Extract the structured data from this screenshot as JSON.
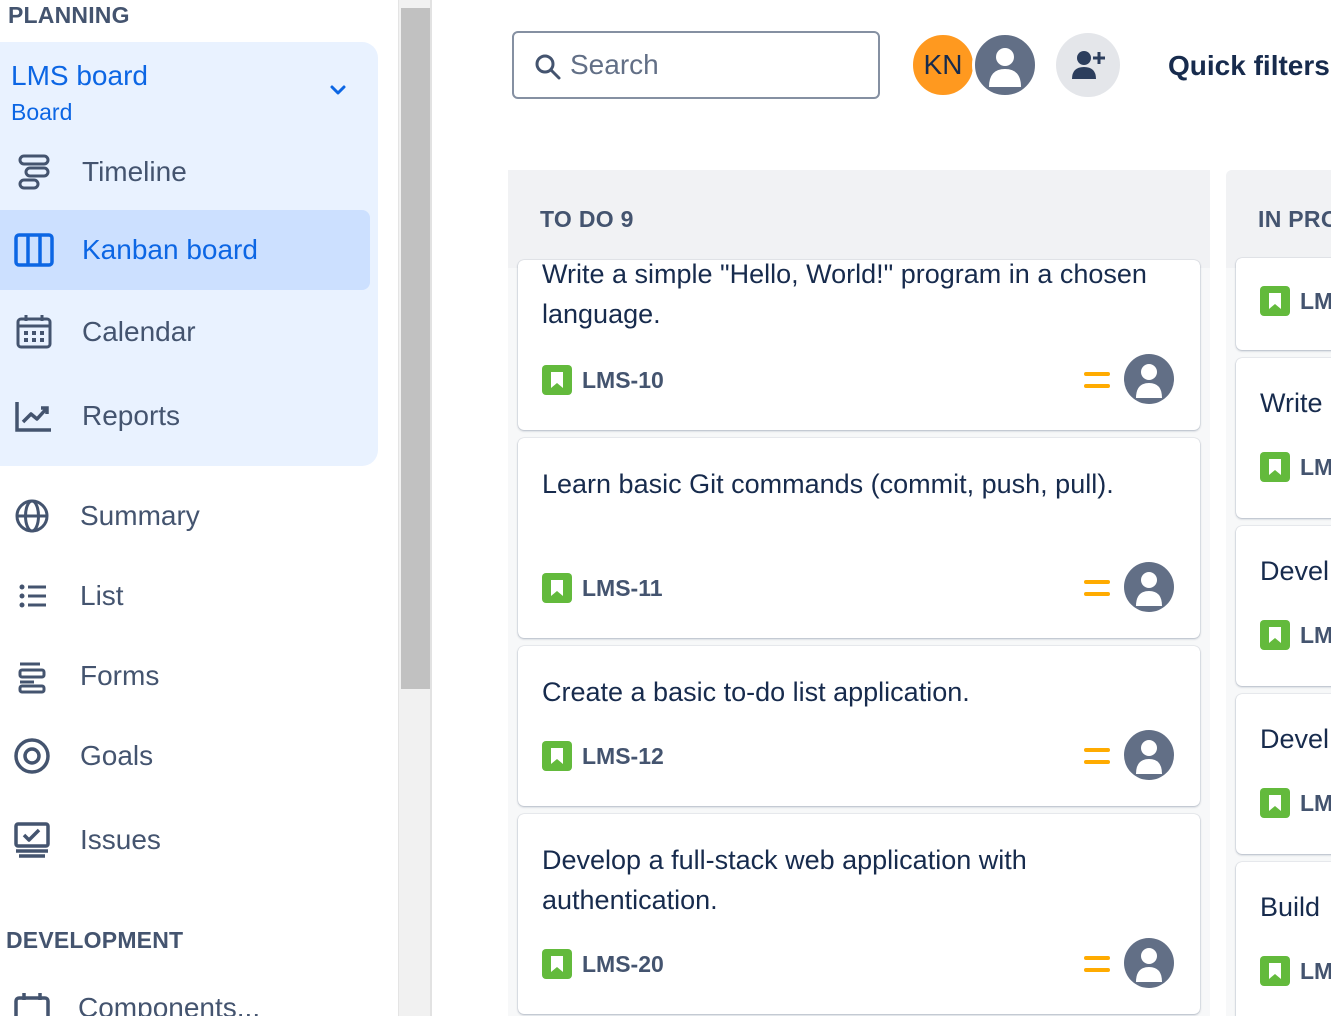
{
  "sidebar": {
    "planning_label": "PLANNING",
    "board_title": "LMS board",
    "board_subtitle": "Board",
    "items": [
      {
        "label": "Timeline"
      },
      {
        "label": "Kanban board"
      },
      {
        "label": "Calendar"
      },
      {
        "label": "Reports"
      },
      {
        "label": "Summary"
      },
      {
        "label": "List"
      },
      {
        "label": "Forms"
      },
      {
        "label": "Goals"
      },
      {
        "label": "Issues"
      }
    ],
    "development_label": "DEVELOPMENT",
    "development_items": [
      {
        "label": "Components..."
      }
    ]
  },
  "topbar": {
    "search_placeholder": "Search",
    "avatar_initials": "KN",
    "quick_filters": "Quick filters"
  },
  "columns": [
    {
      "header": "TO DO 9",
      "cards": [
        {
          "title": "Write a simple \"Hello, World!\" program in a chosen language.",
          "key": "LMS-10"
        },
        {
          "title": "Learn basic Git commands (commit, push, pull).",
          "key": "LMS-11"
        },
        {
          "title": "Create a basic to-do list application.",
          "key": "LMS-12"
        },
        {
          "title": "Develop a full-stack web application with authentication.",
          "key": "LMS-20"
        }
      ]
    },
    {
      "header": "IN PRO",
      "cards": [
        {
          "title": "",
          "key": "LM"
        },
        {
          "title": "Write",
          "key": "LM"
        },
        {
          "title": "Devel",
          "key": "LM"
        },
        {
          "title": "Devel",
          "key": "LM"
        },
        {
          "title": "Build",
          "key": "LM"
        }
      ]
    }
  ],
  "colors": {
    "accent": "#0c66e4",
    "active_bg": "#cce0ff",
    "panel_bg": "#e9f2ff",
    "story": "#63ba3c",
    "priority_medium": "#ffab00",
    "avatar_kn": "#ff991f"
  },
  "icons": {
    "priority": "priority-medium-icon",
    "issue_type": "story-icon",
    "assignee": "unassigned-avatar-icon"
  }
}
